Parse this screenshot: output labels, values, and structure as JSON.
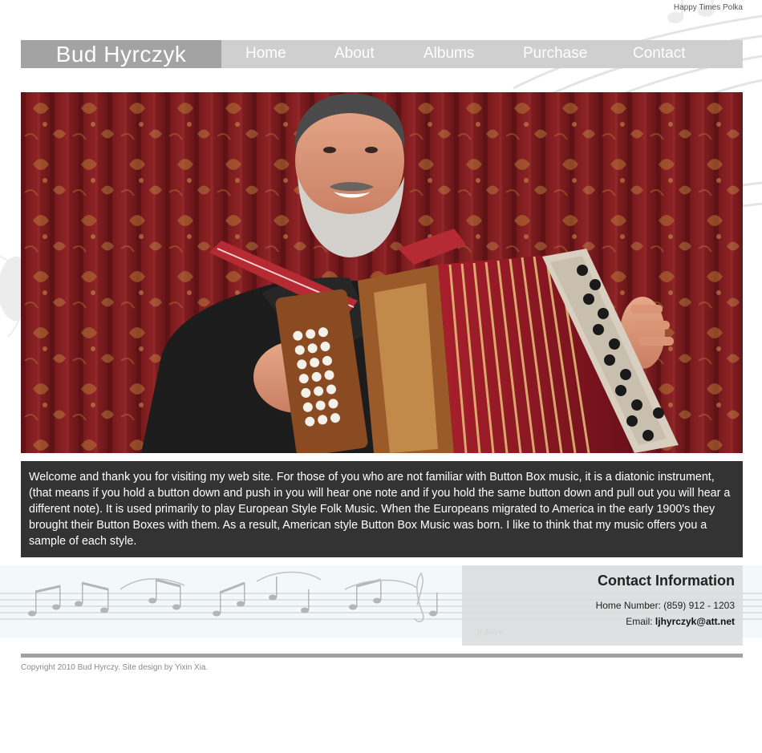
{
  "header": {
    "top_note": "Happy Times Polka",
    "brand": "Bud Hyrczyk"
  },
  "nav": {
    "items": [
      {
        "label": "Home"
      },
      {
        "label": "About"
      },
      {
        "label": "Albums"
      },
      {
        "label": "Purchase"
      },
      {
        "label": "Contact"
      }
    ]
  },
  "hero": {
    "alt": "Bud Hyrczyk playing a button box accordion in front of a red curtain"
  },
  "intro": {
    "text": "Welcome and thank you for visiting my web site. For those of you who are not familiar with Button Box music, it is a diatonic instrument, (that means if you hold a button down and push in you will hear one note and if you hold the same button down and pull out you will hear a different note). It is used primarily to play European Style Folk Music. When the Europeans migrated to America in the early 1900's they brought their Button Boxes with them. As a result, American style Button Box Music was born. I like to think that my music offers you a sample of each style."
  },
  "contact": {
    "title": "Contact Information",
    "phone_label": "Home Number:",
    "phone_value": "(859) 912 - 1203",
    "email_label": "Email:",
    "email_value": "ljhyrczyk@att.net"
  },
  "footer": {
    "copyright": "Copyright 2010 Bud Hyrczy. Site design by Yixin Xia."
  },
  "colors": {
    "nav_bg": "#cfcfcf",
    "brand_bg": "#a3a3a3",
    "intro_bg": "#333333",
    "contact_bg": "#dadada",
    "curtain": "#7a1c1e"
  }
}
